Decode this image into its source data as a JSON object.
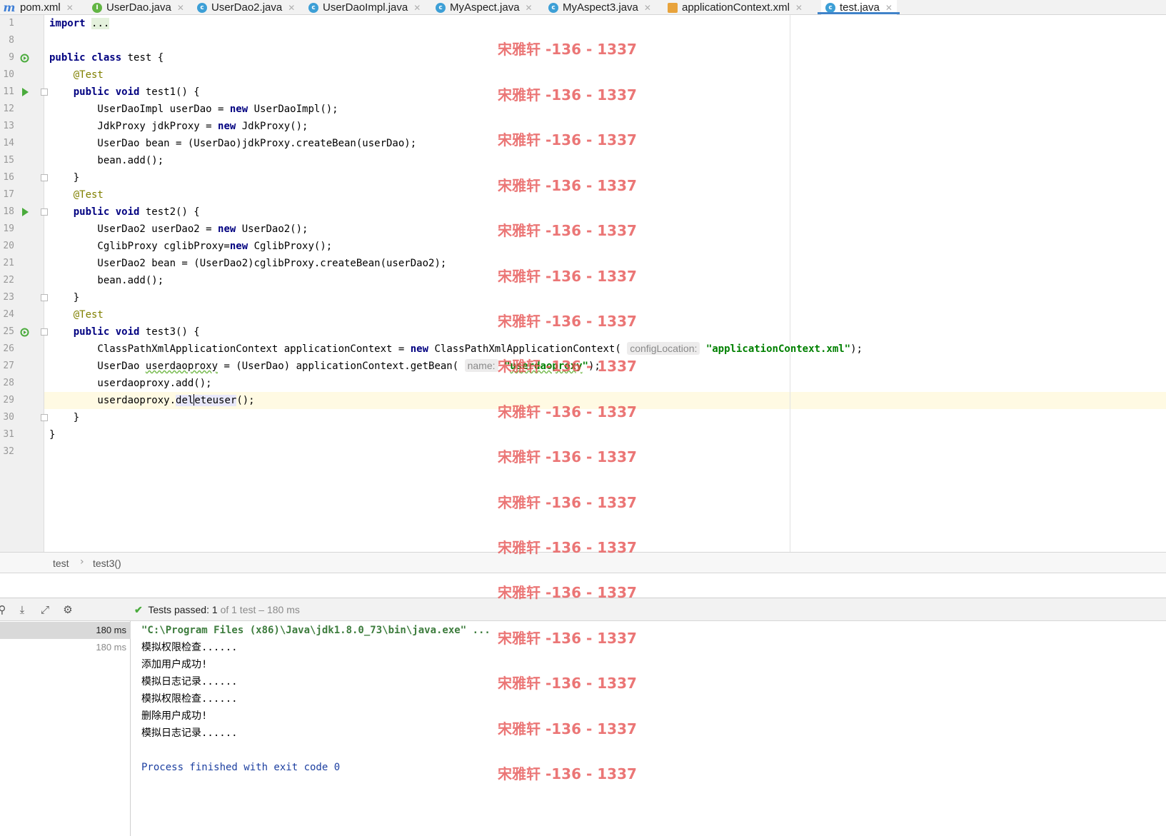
{
  "tabs": [
    {
      "label": "pom.xml",
      "icon": "maven-icon"
    },
    {
      "label": "UserDao.java",
      "icon": "interface-icon"
    },
    {
      "label": "UserDao2.java",
      "icon": "class-icon"
    },
    {
      "label": "UserDaoImpl.java",
      "icon": "class-icon"
    },
    {
      "label": "MyAspect.java",
      "icon": "class-icon"
    },
    {
      "label": "MyAspect3.java",
      "icon": "class-icon"
    },
    {
      "label": "applicationContext.xml",
      "icon": "xml-icon"
    },
    {
      "label": "test.java",
      "icon": "class-icon",
      "active": true
    }
  ],
  "editor": {
    "lines": [
      {
        "no": "1",
        "html": "<span class=\"kw\">import</span> <span class=\"fold-dots\">...</span>"
      },
      {
        "no": "8",
        "html": ""
      },
      {
        "no": "9",
        "html": "<span class=\"kw\">public class</span> test {"
      },
      {
        "no": "10",
        "html": "    <span class=\"ann\">@Test</span>"
      },
      {
        "no": "11",
        "html": "    <span class=\"kw\">public void</span> test1() {"
      },
      {
        "no": "12",
        "html": "        UserDaoImpl userDao = <span class=\"kw\">new</span> UserDaoImpl();"
      },
      {
        "no": "13",
        "html": "        JdkProxy jdkProxy = <span class=\"kw\">new</span> JdkProxy();"
      },
      {
        "no": "14",
        "html": "        UserDao bean = (UserDao)jdkProxy.createBean(userDao);"
      },
      {
        "no": "15",
        "html": "        bean.add();"
      },
      {
        "no": "16",
        "html": "    }"
      },
      {
        "no": "17",
        "html": "    <span class=\"ann\">@Test</span>"
      },
      {
        "no": "18",
        "html": "    <span class=\"kw\">public void</span> test2() {"
      },
      {
        "no": "19",
        "html": "        UserDao2 userDao2 = <span class=\"kw\">new</span> UserDao2();"
      },
      {
        "no": "20",
        "html": "        CglibProxy cglibProxy=<span class=\"kw\">new</span> CglibProxy();"
      },
      {
        "no": "21",
        "html": "        UserDao2 bean = (UserDao2)cglibProxy.createBean(userDao2);"
      },
      {
        "no": "22",
        "html": "        bean.add();"
      },
      {
        "no": "23",
        "html": "    }"
      },
      {
        "no": "24",
        "html": "    <span class=\"ann\">@Test</span>"
      },
      {
        "no": "25",
        "html": "    <span class=\"kw\">public void</span> test3() {"
      },
      {
        "no": "26",
        "html": "        ClassPathXmlApplicationContext applicationContext = <span class=\"kw\">new</span> ClassPathXmlApplicationContext( <span class=\"hint\">configLocation:</span> <span class=\"str\">\"applicationContext.xml\"</span>);"
      },
      {
        "no": "27",
        "html": "        UserDao <span class=\"wavy\">userdaoproxy</span> = (UserDao) applicationContext.getBean( <span class=\"hint\">name:</span> <span class=\"str\">\"<span class=\"wavy\">userdaoproxy</span>\"</span>);"
      },
      {
        "no": "28",
        "html": "        userdaoproxy.add();"
      },
      {
        "no": "29",
        "html": "        userdaoproxy.<span class=\"sel-word\">del<span class=\"caret\"></span>eteuser</span>();"
      },
      {
        "no": "30",
        "html": "    }"
      },
      {
        "no": "31",
        "html": "}"
      },
      {
        "no": "32",
        "html": ""
      }
    ]
  },
  "breadcrumb": {
    "class": "test",
    "method": "test3()"
  },
  "run": {
    "status_label": "Tests passed:",
    "passed": "1",
    "of_text": "of 1 test",
    "duration": "– 180 ms",
    "tree": [
      {
        "label": "180 ms",
        "selected": true
      },
      {
        "label": "180 ms",
        "selected": false
      }
    ],
    "console": [
      {
        "text": "\"C:\\Program Files (x86)\\Java\\jdk1.8.0_73\\bin\\java.exe\" ...",
        "kind": "cmd"
      },
      {
        "text": "模拟权限检查......",
        "kind": "out"
      },
      {
        "text": "添加用户成功!",
        "kind": "out"
      },
      {
        "text": "模拟日志记录......",
        "kind": "out"
      },
      {
        "text": "模拟权限检查......",
        "kind": "out"
      },
      {
        "text": "删除用户成功!",
        "kind": "out"
      },
      {
        "text": "模拟日志记录......",
        "kind": "out"
      },
      {
        "text": "",
        "kind": "out"
      },
      {
        "text": "Process finished with exit code 0",
        "kind": "fin"
      }
    ]
  },
  "watermark": "宋雅轩 -136 - 1337",
  "colors": {
    "accent": "#4083c9",
    "keyword": "#000080",
    "annotation": "#808000",
    "string": "#008000",
    "run_green": "#4aab3c",
    "watermark": "#e65050"
  }
}
